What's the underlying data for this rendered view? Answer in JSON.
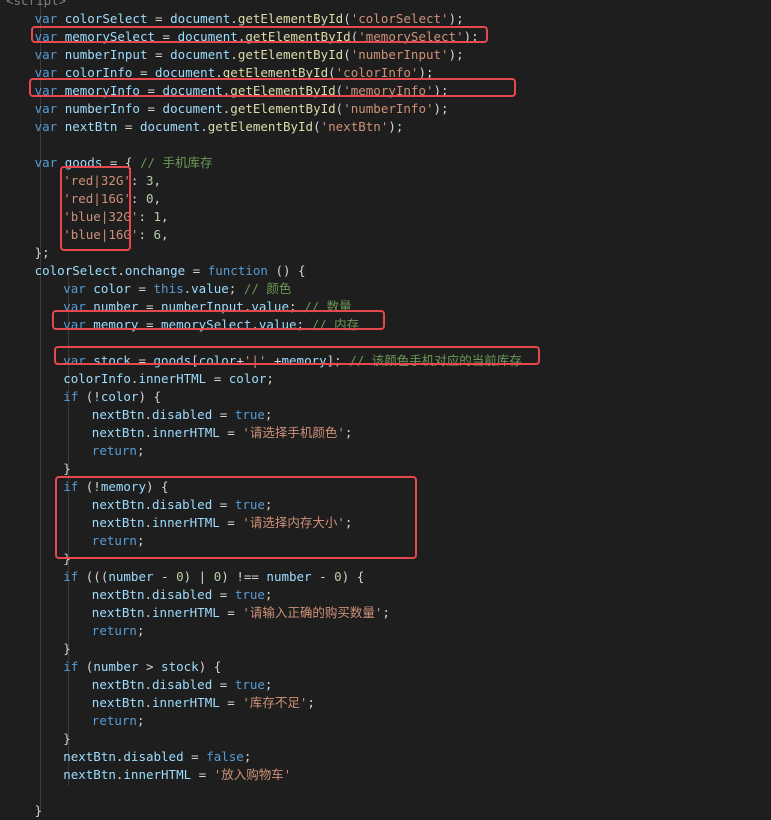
{
  "code_lines": [
    {
      "indent": 0,
      "tokens": [
        [
          "tag",
          "<script>"
        ]
      ]
    },
    {
      "indent": 1,
      "tokens": [
        [
          "kw",
          "var "
        ],
        [
          "var",
          "colorSelect"
        ],
        [
          "pun",
          " = "
        ],
        [
          "var",
          "document"
        ],
        [
          "pun",
          "."
        ],
        [
          "fn",
          "getElementById"
        ],
        [
          "pun",
          "("
        ],
        [
          "str",
          "'colorSelect'"
        ],
        [
          "pun",
          ");"
        ]
      ]
    },
    {
      "indent": 1,
      "tokens": [
        [
          "kw",
          "var "
        ],
        [
          "var",
          "memorySelect"
        ],
        [
          "pun",
          " = "
        ],
        [
          "var",
          "document"
        ],
        [
          "pun",
          "."
        ],
        [
          "fn",
          "getElementById"
        ],
        [
          "pun",
          "("
        ],
        [
          "str",
          "'memorySelect'"
        ],
        [
          "pun",
          ");"
        ]
      ]
    },
    {
      "indent": 1,
      "tokens": [
        [
          "kw",
          "var "
        ],
        [
          "var",
          "numberInput"
        ],
        [
          "pun",
          " = "
        ],
        [
          "var",
          "document"
        ],
        [
          "pun",
          "."
        ],
        [
          "fn",
          "getElementById"
        ],
        [
          "pun",
          "("
        ],
        [
          "str",
          "'numberInput'"
        ],
        [
          "pun",
          ");"
        ]
      ]
    },
    {
      "indent": 1,
      "tokens": [
        [
          "kw",
          "var "
        ],
        [
          "var",
          "colorInfo"
        ],
        [
          "pun",
          " = "
        ],
        [
          "var",
          "document"
        ],
        [
          "pun",
          "."
        ],
        [
          "fn",
          "getElementById"
        ],
        [
          "pun",
          "("
        ],
        [
          "str",
          "'colorInfo'"
        ],
        [
          "pun",
          ");"
        ]
      ]
    },
    {
      "indent": 1,
      "tokens": [
        [
          "kw",
          "var "
        ],
        [
          "var",
          "memoryInfo"
        ],
        [
          "pun",
          " = "
        ],
        [
          "var",
          "document"
        ],
        [
          "pun",
          "."
        ],
        [
          "fn",
          "getElementById"
        ],
        [
          "pun",
          "("
        ],
        [
          "str",
          "'memoryInfo'"
        ],
        [
          "pun",
          ");"
        ]
      ]
    },
    {
      "indent": 1,
      "tokens": [
        [
          "kw",
          "var "
        ],
        [
          "var",
          "numberInfo"
        ],
        [
          "pun",
          " = "
        ],
        [
          "var",
          "document"
        ],
        [
          "pun",
          "."
        ],
        [
          "fn",
          "getElementById"
        ],
        [
          "pun",
          "("
        ],
        [
          "str",
          "'numberInfo'"
        ],
        [
          "pun",
          ");"
        ]
      ]
    },
    {
      "indent": 1,
      "tokens": [
        [
          "kw",
          "var "
        ],
        [
          "var",
          "nextBtn"
        ],
        [
          "pun",
          " = "
        ],
        [
          "var",
          "document"
        ],
        [
          "pun",
          "."
        ],
        [
          "fn",
          "getElementById"
        ],
        [
          "pun",
          "("
        ],
        [
          "str",
          "'nextBtn'"
        ],
        [
          "pun",
          ");"
        ]
      ]
    },
    {
      "indent": 0,
      "tokens": []
    },
    {
      "indent": 1,
      "tokens": [
        [
          "kw",
          "var "
        ],
        [
          "var",
          "goods"
        ],
        [
          "pun",
          " = { "
        ],
        [
          "cmt",
          "// 手机库存"
        ]
      ]
    },
    {
      "indent": 2,
      "tokens": [
        [
          "str",
          "'red|32G'"
        ],
        [
          "pun",
          ": "
        ],
        [
          "num",
          "3"
        ],
        [
          "pun",
          ","
        ]
      ]
    },
    {
      "indent": 2,
      "tokens": [
        [
          "str",
          "'red|16G'"
        ],
        [
          "pun",
          ": "
        ],
        [
          "num",
          "0"
        ],
        [
          "pun",
          ","
        ]
      ]
    },
    {
      "indent": 2,
      "tokens": [
        [
          "str",
          "'blue|32G'"
        ],
        [
          "pun",
          ": "
        ],
        [
          "num",
          "1"
        ],
        [
          "pun",
          ","
        ]
      ]
    },
    {
      "indent": 2,
      "tokens": [
        [
          "str",
          "'blue|16G'"
        ],
        [
          "pun",
          ": "
        ],
        [
          "num",
          "6"
        ],
        [
          "pun",
          ","
        ]
      ]
    },
    {
      "indent": 1,
      "tokens": [
        [
          "pun",
          "};"
        ]
      ]
    },
    {
      "indent": 1,
      "tokens": [
        [
          "var",
          "colorSelect"
        ],
        [
          "pun",
          "."
        ],
        [
          "var",
          "onchange"
        ],
        [
          "pun",
          " = "
        ],
        [
          "kw",
          "function"
        ],
        [
          "pun",
          " () {"
        ]
      ]
    },
    {
      "indent": 2,
      "tokens": [
        [
          "kw",
          "var "
        ],
        [
          "var",
          "color"
        ],
        [
          "pun",
          " = "
        ],
        [
          "kw",
          "this"
        ],
        [
          "pun",
          "."
        ],
        [
          "var",
          "value"
        ],
        [
          "pun",
          "; "
        ],
        [
          "cmt",
          "// 颜色"
        ]
      ]
    },
    {
      "indent": 2,
      "tokens": [
        [
          "kw",
          "var "
        ],
        [
          "var",
          "number"
        ],
        [
          "pun",
          " = "
        ],
        [
          "var",
          "numberInput"
        ],
        [
          "pun",
          "."
        ],
        [
          "var",
          "value"
        ],
        [
          "pun",
          "; "
        ],
        [
          "cmt",
          "// 数量"
        ]
      ]
    },
    {
      "indent": 2,
      "tokens": [
        [
          "kw",
          "var "
        ],
        [
          "var",
          "memory"
        ],
        [
          "pun",
          " = "
        ],
        [
          "var",
          "memorySelect"
        ],
        [
          "pun",
          "."
        ],
        [
          "var",
          "value"
        ],
        [
          "pun",
          "; "
        ],
        [
          "cmt",
          "// 内存"
        ]
      ]
    },
    {
      "indent": 0,
      "tokens": []
    },
    {
      "indent": 2,
      "tokens": [
        [
          "kw",
          "var "
        ],
        [
          "var",
          "stock"
        ],
        [
          "pun",
          " = "
        ],
        [
          "var",
          "goods"
        ],
        [
          "pun",
          "["
        ],
        [
          "var",
          "color"
        ],
        [
          "pun",
          "+"
        ],
        [
          "str",
          "'|'"
        ],
        [
          "pun",
          " +"
        ],
        [
          "var",
          "memory"
        ],
        [
          "pun",
          "]; "
        ],
        [
          "cmt",
          "// 该颜色手机对应的当前库存"
        ]
      ]
    },
    {
      "indent": 2,
      "tokens": [
        [
          "var",
          "colorInfo"
        ],
        [
          "pun",
          "."
        ],
        [
          "var",
          "innerHTML"
        ],
        [
          "pun",
          " = "
        ],
        [
          "var",
          "color"
        ],
        [
          "pun",
          ";"
        ]
      ]
    },
    {
      "indent": 2,
      "tokens": [
        [
          "kw",
          "if"
        ],
        [
          "pun",
          " (!"
        ],
        [
          "var",
          "color"
        ],
        [
          "pun",
          ") {"
        ]
      ]
    },
    {
      "indent": 3,
      "tokens": [
        [
          "var",
          "nextBtn"
        ],
        [
          "pun",
          "."
        ],
        [
          "var",
          "disabled"
        ],
        [
          "pun",
          " = "
        ],
        [
          "kw",
          "true"
        ],
        [
          "pun",
          ";"
        ]
      ]
    },
    {
      "indent": 3,
      "tokens": [
        [
          "var",
          "nextBtn"
        ],
        [
          "pun",
          "."
        ],
        [
          "var",
          "innerHTML"
        ],
        [
          "pun",
          " = "
        ],
        [
          "str",
          "'请选择手机颜色'"
        ],
        [
          "pun",
          ";"
        ]
      ]
    },
    {
      "indent": 3,
      "tokens": [
        [
          "kw",
          "return"
        ],
        [
          "pun",
          ";"
        ]
      ]
    },
    {
      "indent": 2,
      "tokens": [
        [
          "pun",
          "}"
        ]
      ]
    },
    {
      "indent": 2,
      "tokens": [
        [
          "kw",
          "if"
        ],
        [
          "pun",
          " (!"
        ],
        [
          "var",
          "memory"
        ],
        [
          "pun",
          ") {"
        ]
      ]
    },
    {
      "indent": 3,
      "tokens": [
        [
          "var",
          "nextBtn"
        ],
        [
          "pun",
          "."
        ],
        [
          "var",
          "disabled"
        ],
        [
          "pun",
          " = "
        ],
        [
          "kw",
          "true"
        ],
        [
          "pun",
          ";"
        ]
      ]
    },
    {
      "indent": 3,
      "tokens": [
        [
          "var",
          "nextBtn"
        ],
        [
          "pun",
          "."
        ],
        [
          "var",
          "innerHTML"
        ],
        [
          "pun",
          " = "
        ],
        [
          "str",
          "'请选择内存大小'"
        ],
        [
          "pun",
          ";"
        ]
      ]
    },
    {
      "indent": 3,
      "tokens": [
        [
          "kw",
          "return"
        ],
        [
          "pun",
          ";"
        ]
      ]
    },
    {
      "indent": 2,
      "tokens": [
        [
          "pun",
          "}"
        ]
      ]
    },
    {
      "indent": 2,
      "tokens": [
        [
          "kw",
          "if"
        ],
        [
          "pun",
          " ((("
        ],
        [
          "var",
          "number"
        ],
        [
          "pun",
          " - "
        ],
        [
          "num",
          "0"
        ],
        [
          "pun",
          ") | "
        ],
        [
          "num",
          "0"
        ],
        [
          "pun",
          ") !== "
        ],
        [
          "var",
          "number"
        ],
        [
          "pun",
          " - "
        ],
        [
          "num",
          "0"
        ],
        [
          "pun",
          ") {"
        ]
      ]
    },
    {
      "indent": 3,
      "tokens": [
        [
          "var",
          "nextBtn"
        ],
        [
          "pun",
          "."
        ],
        [
          "var",
          "disabled"
        ],
        [
          "pun",
          " = "
        ],
        [
          "kw",
          "true"
        ],
        [
          "pun",
          ";"
        ]
      ]
    },
    {
      "indent": 3,
      "tokens": [
        [
          "var",
          "nextBtn"
        ],
        [
          "pun",
          "."
        ],
        [
          "var",
          "innerHTML"
        ],
        [
          "pun",
          " = "
        ],
        [
          "str",
          "'请输入正确的购买数量'"
        ],
        [
          "pun",
          ";"
        ]
      ]
    },
    {
      "indent": 3,
      "tokens": [
        [
          "kw",
          "return"
        ],
        [
          "pun",
          ";"
        ]
      ]
    },
    {
      "indent": 2,
      "tokens": [
        [
          "pun",
          "}"
        ]
      ]
    },
    {
      "indent": 2,
      "tokens": [
        [
          "kw",
          "if"
        ],
        [
          "pun",
          " ("
        ],
        [
          "var",
          "number"
        ],
        [
          "pun",
          " > "
        ],
        [
          "var",
          "stock"
        ],
        [
          "pun",
          ") {"
        ]
      ]
    },
    {
      "indent": 3,
      "tokens": [
        [
          "var",
          "nextBtn"
        ],
        [
          "pun",
          "."
        ],
        [
          "var",
          "disabled"
        ],
        [
          "pun",
          " = "
        ],
        [
          "kw",
          "true"
        ],
        [
          "pun",
          ";"
        ]
      ]
    },
    {
      "indent": 3,
      "tokens": [
        [
          "var",
          "nextBtn"
        ],
        [
          "pun",
          "."
        ],
        [
          "var",
          "innerHTML"
        ],
        [
          "pun",
          " = "
        ],
        [
          "str",
          "'库存不足'"
        ],
        [
          "pun",
          ";"
        ]
      ]
    },
    {
      "indent": 3,
      "tokens": [
        [
          "kw",
          "return"
        ],
        [
          "pun",
          ";"
        ]
      ]
    },
    {
      "indent": 2,
      "tokens": [
        [
          "pun",
          "}"
        ]
      ]
    },
    {
      "indent": 2,
      "tokens": [
        [
          "var",
          "nextBtn"
        ],
        [
          "pun",
          "."
        ],
        [
          "var",
          "disabled"
        ],
        [
          "pun",
          " = "
        ],
        [
          "kw",
          "false"
        ],
        [
          "pun",
          ";"
        ]
      ]
    },
    {
      "indent": 2,
      "tokens": [
        [
          "var",
          "nextBtn"
        ],
        [
          "pun",
          "."
        ],
        [
          "var",
          "innerHTML"
        ],
        [
          "pun",
          " = "
        ],
        [
          "str",
          "'放入购物车'"
        ]
      ]
    },
    {
      "indent": 0,
      "tokens": []
    },
    {
      "indent": 1,
      "tokens": [
        [
          "pun",
          "}"
        ]
      ]
    }
  ],
  "colors": {
    "background": "#1e1e1e",
    "highlight_box": "#e5484d",
    "keyword": "#569cd6",
    "variable": "#9cdcfe",
    "function": "#dcdcaa",
    "string": "#ce9178",
    "comment": "#6a9955",
    "number": "#b5cea8"
  }
}
